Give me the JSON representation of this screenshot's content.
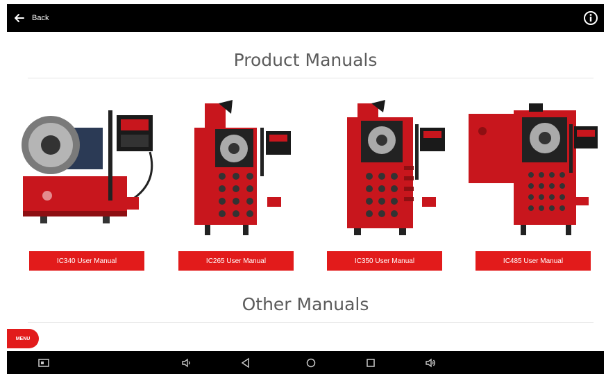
{
  "header": {
    "back_label": "Back",
    "icons": {
      "back": "arrow-left-icon",
      "info": "info-icon"
    }
  },
  "sections": {
    "product_title": "Product Manuals",
    "other_title": "Other Manuals"
  },
  "products": [
    {
      "button_label": "IC340 User Manual",
      "image": "ic340-machine"
    },
    {
      "button_label": "IC265 User Manual",
      "image": "ic265-machine"
    },
    {
      "button_label": "IC350 User Manual",
      "image": "ic350-machine"
    },
    {
      "button_label": "IC485 User Manual",
      "image": "ic485-machine"
    }
  ],
  "menu_label": "MENU",
  "navbar": {
    "icons": [
      "screenshot-icon",
      "volume-down-icon",
      "back-triangle-icon",
      "home-circle-icon",
      "recents-square-icon",
      "volume-up-icon"
    ]
  },
  "colors": {
    "accent": "#e21b1b",
    "bar": "#000000",
    "title": "#5b5b5b"
  }
}
